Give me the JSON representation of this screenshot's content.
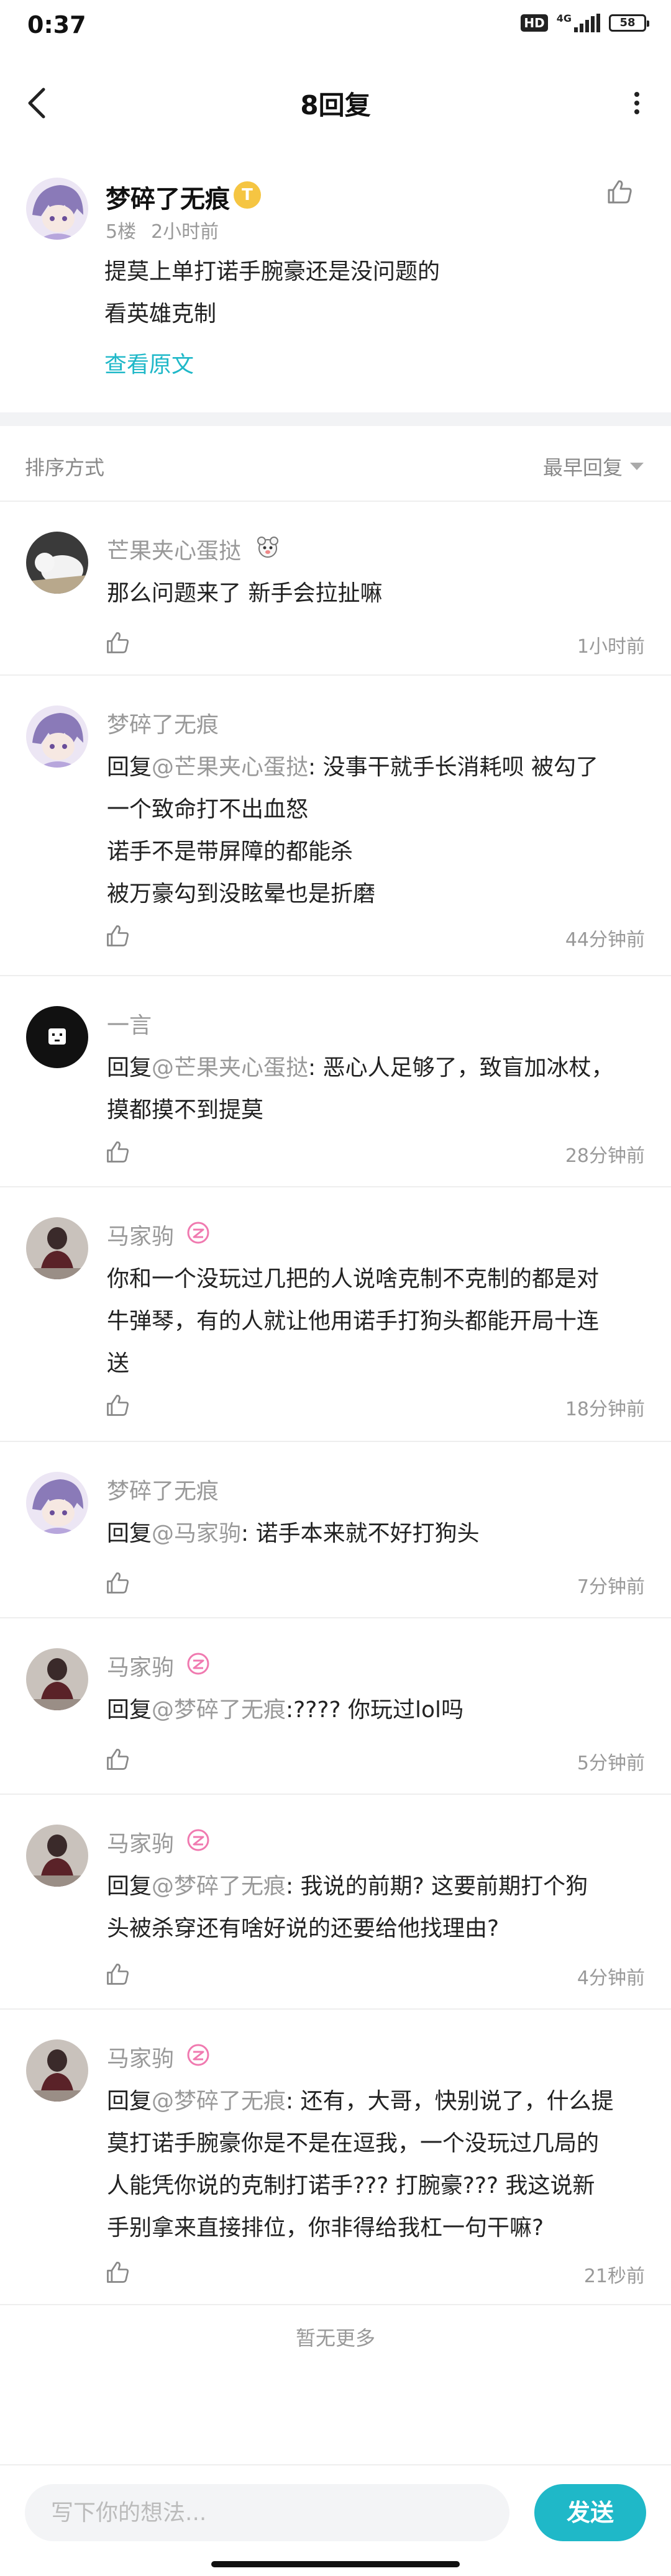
{
  "status_bar": {
    "time": "0:37",
    "hd": "HD",
    "network": "4G",
    "battery": "58"
  },
  "header": {
    "title": "8回复"
  },
  "original_post": {
    "author": "梦碎了无痕",
    "badge": "T",
    "floor": "5楼",
    "time": "2小时前",
    "lines": [
      "提莫上单打诺手腕豪还是没问题的",
      "看英雄克制"
    ],
    "view_original": "查看原文"
  },
  "sort": {
    "label": "排序方式",
    "value": "最早回复"
  },
  "comments": [
    {
      "author": "芒果夹心蛋挞",
      "lines": [
        "那么问题来了 新手会拉扯嘛"
      ],
      "time": "1小时前"
    },
    {
      "author": "梦碎了无痕",
      "reply_prefix": "回复",
      "mention": "@芒果夹心蛋挞",
      "lines": [
        ": 没事干就手长消耗呗 被勾了",
        "一个致命打不出血怒",
        "诺手不是带屏障的都能杀",
        "被万豪勾到没眩晕也是折磨"
      ],
      "time": "44分钟前"
    },
    {
      "author": "一言",
      "reply_prefix": "回复",
      "mention": "@芒果夹心蛋挞",
      "lines": [
        ": 恶心人足够了，致盲加冰杖，",
        "摸都摸不到提莫"
      ],
      "time": "28分钟前"
    },
    {
      "author": "马家驹",
      "lines": [
        "你和一个没玩过几把的人说啥克制不克制的都是对",
        "牛弹琴，有的人就让他用诺手打狗头都能开局十连",
        "送"
      ],
      "time": "18分钟前"
    },
    {
      "author": "梦碎了无痕",
      "reply_prefix": "回复",
      "mention": "@马家驹",
      "lines": [
        ": 诺手本来就不好打狗头"
      ],
      "time": "7分钟前"
    },
    {
      "author": "马家驹",
      "reply_prefix": "回复",
      "mention": "@梦碎了无痕",
      "lines": [
        ":???? 你玩过lol吗"
      ],
      "time": "5分钟前"
    },
    {
      "author": "马家驹",
      "reply_prefix": "回复",
      "mention": "@梦碎了无痕",
      "lines": [
        ": 我说的前期? 这要前期打个狗",
        "头被杀穿还有啥好说的还要给他找理由?"
      ],
      "time": "4分钟前"
    },
    {
      "author": "马家驹",
      "reply_prefix": "回复",
      "mention": "@梦碎了无痕",
      "lines": [
        ": 还有，大哥，快别说了，什么提",
        "莫打诺手腕豪你是不是在逗我，一个没玩过几局的",
        "人能凭你说的克制打诺手??? 打腕豪??? 我这说新",
        "手别拿来直接排位，你非得给我杠一句干嘛?"
      ],
      "time": "21秒前"
    }
  ],
  "no_more": "暂无更多",
  "composer": {
    "placeholder": "写下你的想法...",
    "send_label": "发送"
  },
  "colors": {
    "accent": "#1fb8c8",
    "muted": "#999999",
    "vip_badge": "#f5c542",
    "lv_badge": "#f07ab0"
  },
  "icons": [
    "back-arrow-icon",
    "more-vertical-icon",
    "thumb-up-icon",
    "sort-caret-icon",
    "level-badge-icon"
  ]
}
